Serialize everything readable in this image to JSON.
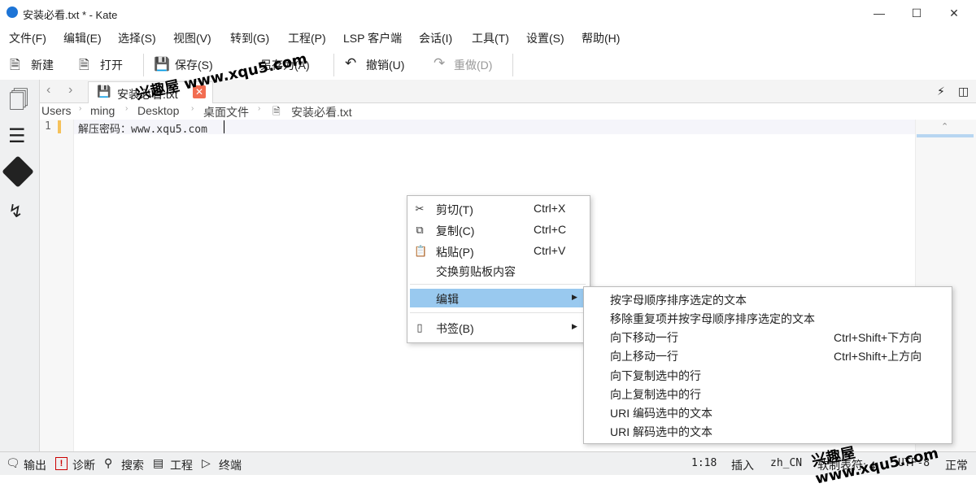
{
  "window": {
    "title": "安装必看.txt * - Kate",
    "minimize_icon": "minimize-icon",
    "maximize_icon": "maximize-icon",
    "close_icon": "close-icon"
  },
  "menubar": [
    "文件(F)",
    "编辑(E)",
    "选择(S)",
    "视图(V)",
    "转到(G)",
    "工程(P)",
    "LSP 客户端",
    "会话(I)",
    "工具(T)",
    "设置(S)",
    "帮助(H)"
  ],
  "toolbar": {
    "new": "新建",
    "open": "打开",
    "save": "保存(S)",
    "save_as": "另存为(A)",
    "undo": "撤销(U)",
    "redo": "重做(D)"
  },
  "tab": {
    "label": "安装必看.txt"
  },
  "breadcrumb": [
    "Users",
    "ming",
    "Desktop",
    "桌面文件",
    "安装必看.txt"
  ],
  "editor": {
    "line_number": "1",
    "line_text": "解压密码：www.xqu5.com"
  },
  "context_menu": {
    "items": [
      {
        "label": "剪切(T)",
        "shortcut": "Ctrl+X",
        "icon": "scissors-icon"
      },
      {
        "label": "复制(C)",
        "shortcut": "Ctrl+C",
        "icon": "copy-icon"
      },
      {
        "label": "粘贴(P)",
        "shortcut": "Ctrl+V",
        "icon": "clipboard-icon"
      },
      {
        "label": "交换剪贴板内容",
        "shortcut": ""
      }
    ],
    "edit": "编辑",
    "bookmarks": "书签(B)"
  },
  "submenu": [
    {
      "label": "按字母顺序排序选定的文本",
      "shortcut": ""
    },
    {
      "label": "移除重复项并按字母顺序排序选定的文本",
      "shortcut": ""
    },
    {
      "label": "向下移动一行",
      "shortcut": "Ctrl+Shift+下方向"
    },
    {
      "label": "向上移动一行",
      "shortcut": "Ctrl+Shift+上方向"
    },
    {
      "label": "向下复制选中的行",
      "shortcut": ""
    },
    {
      "label": "向上复制选中的行",
      "shortcut": ""
    },
    {
      "label": "URI 编码选中的文本",
      "shortcut": ""
    },
    {
      "label": "URI 解码选中的文本",
      "shortcut": ""
    }
  ],
  "statusbar": {
    "output": "输出",
    "diagnostics": "诊断",
    "search": "搜索",
    "project": "工程",
    "terminal": "终端",
    "position": "1:18",
    "mode": "插入",
    "lang": "zh_CN",
    "tab_width": "软制表符: 4",
    "encoding": "UTF-8",
    "state": "正常"
  },
  "watermark": "兴趣屋 www.xqu5.com"
}
